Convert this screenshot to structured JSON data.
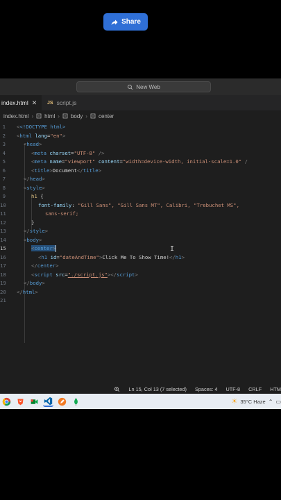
{
  "share": {
    "label": "Share"
  },
  "titlebar": {
    "search_text": "New Web"
  },
  "tabs": [
    {
      "label": "index.html",
      "active": true
    },
    {
      "label": "script.js",
      "badge": "JS",
      "active": false
    }
  ],
  "breadcrumbs": [
    "index.html",
    "html",
    "body",
    "center"
  ],
  "code": {
    "line_numbers": [
      "1",
      "2",
      "3",
      "4",
      "5",
      "6",
      "7",
      "8",
      "9",
      "10",
      "11",
      "12",
      "13",
      "14",
      "15",
      "16",
      "17",
      "18",
      "19",
      "20",
      "21"
    ],
    "l1": "<!DOCTYPE html>",
    "l2": {
      "tag": "html",
      "attr": "lang",
      "val": "\"en\""
    },
    "l3": "head",
    "l4": {
      "tag": "meta",
      "attr": "charset",
      "val": "\"UTF-8\""
    },
    "l5": {
      "tag": "meta",
      "attr1": "name",
      "val1": "\"viewport\"",
      "attr2": "content",
      "val2": "\"width=device-width, initial-scale=1.0\""
    },
    "l6": {
      "tag": "title",
      "text": "Document"
    },
    "l7": "head",
    "l8": "style",
    "l9": "h1",
    "l10": {
      "prop": "font-family",
      "value": "\"Gill Sans\", \"Gill Sans MT\", Calibri, \"Trebuchet MS\","
    },
    "l11": "sans-serif;",
    "l12": "}",
    "l13": "style",
    "l14": "body",
    "l15": "center",
    "l16": {
      "tag": "h1",
      "attr": "id",
      "val": "\"dateAndTime\"",
      "text": "Click Me To Show Time!"
    },
    "l17": "center",
    "l18": {
      "tag": "script",
      "attr": "src",
      "val": "\"./script.js\""
    },
    "l19": "body",
    "l20": "html"
  },
  "status": {
    "position": "Ln 15, Col 13 (7 selected)",
    "spaces": "Spaces: 4",
    "encoding": "UTF-8",
    "eol": "CRLF",
    "lang": "HTM"
  },
  "taskbar": {
    "weather": "35°C Haze"
  },
  "colors": {
    "share_bg": "#2f6fd6",
    "editor_bg": "#1e1e1e",
    "tag": "#569cd6",
    "attr": "#9cdcfe",
    "string": "#ce9178",
    "selector": "#d7ba7d"
  }
}
